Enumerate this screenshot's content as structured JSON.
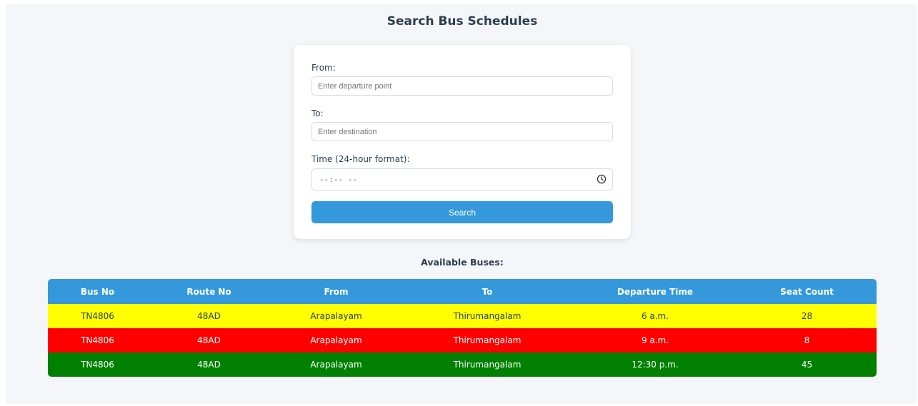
{
  "page": {
    "title": "Search Bus Schedules"
  },
  "form": {
    "from_label": "From:",
    "from_placeholder": "Enter departure point",
    "to_label": "To:",
    "to_placeholder": "Enter destination",
    "time_label": "Time (24-hour format):",
    "time_placeholder": "--:-- --",
    "time_icon": "clock-icon",
    "search_label": "Search"
  },
  "results": {
    "heading": "Available Buses:",
    "columns": [
      "Bus No",
      "Route No",
      "From",
      "To",
      "Departure Time",
      "Seat Count"
    ],
    "rows": [
      {
        "bus_no": "TN4806",
        "route_no": "48AD",
        "from": "Arapalayam",
        "to": "Thirumangalam",
        "departure": "6 a.m.",
        "seats": "28",
        "status_color": "#ffff00"
      },
      {
        "bus_no": "TN4806",
        "route_no": "48AD",
        "from": "Arapalayam",
        "to": "Thirumangalam",
        "departure": "9 a.m.",
        "seats": "8",
        "status_color": "#ff0000"
      },
      {
        "bus_no": "TN4806",
        "route_no": "48AD",
        "from": "Arapalayam",
        "to": "Thirumangalam",
        "departure": "12:30 p.m.",
        "seats": "45",
        "status_color": "#008000"
      }
    ]
  },
  "colors": {
    "accent": "#3498db",
    "background": "#f4f6f9",
    "text": "#2c3e50"
  }
}
